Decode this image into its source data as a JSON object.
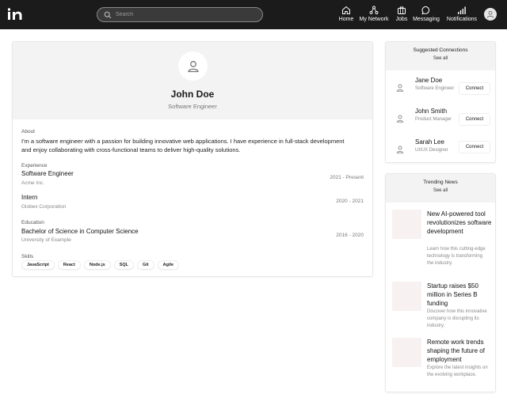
{
  "topbar": {
    "logo": "in-logo",
    "search_placeholder": "Search",
    "nav": [
      {
        "label": "Home",
        "icon": "home-icon"
      },
      {
        "label": "My Network",
        "icon": "network-icon"
      },
      {
        "label": "Jobs",
        "icon": "briefcase-icon"
      },
      {
        "label": "Messaging",
        "icon": "message-icon"
      },
      {
        "label": "Notifications",
        "icon": "signal-icon"
      }
    ]
  },
  "profile": {
    "name": "John Doe",
    "title": "Software Engineer",
    "about_label": "About",
    "about_text": "I'm a software engineer with a passion for building innovative web applications. I have experience in full-stack development and enjoy collaborating with cross-functional teams to deliver high-quality solutions.",
    "experience_label": "Experience",
    "experience": [
      {
        "title": "Software Engineer",
        "org": "Acme Inc.",
        "dates": "2021 - Present"
      },
      {
        "title": "Intern",
        "org": "Globex Corporation",
        "dates": "2020 - 2021"
      }
    ],
    "education_label": "Education",
    "education": [
      {
        "title": "Bachelor of Science in Computer Science",
        "org": "University of Example",
        "dates": "2016 - 2020"
      }
    ],
    "skills_label": "Skills",
    "skills": [
      "JavaScript",
      "React",
      "Node.js",
      "SQL",
      "Git",
      "Agile"
    ]
  },
  "suggested": {
    "title": "Suggested Connections",
    "see_all": "See all",
    "people": [
      {
        "name": "Jane Doe",
        "role": "Software Engineer",
        "button": "Connect"
      },
      {
        "name": "John Smith",
        "role": "Product Manager",
        "button": "Connect"
      },
      {
        "name": "Sarah Lee",
        "role": "UI/UX Designer",
        "button": "Connect"
      }
    ]
  },
  "news": {
    "title": "Trending News",
    "see_all": "See all",
    "items": [
      {
        "title": "New AI-powered tool revolutionizes software development",
        "desc": "Learn how this cutting-edge technology is transforming the industry."
      },
      {
        "title": "Startup raises $50 million in Series B funding",
        "desc": "Discover how this innovative company is disrupting its industry."
      },
      {
        "title": "Remote work trends shaping the future of employment",
        "desc": "Explore the latest insights on the evolving workplace."
      }
    ]
  },
  "colors": {
    "topbar": "#1b1b1b",
    "header_bg": "#f3f3f3",
    "thumb_bg": "#f8f1f1"
  }
}
